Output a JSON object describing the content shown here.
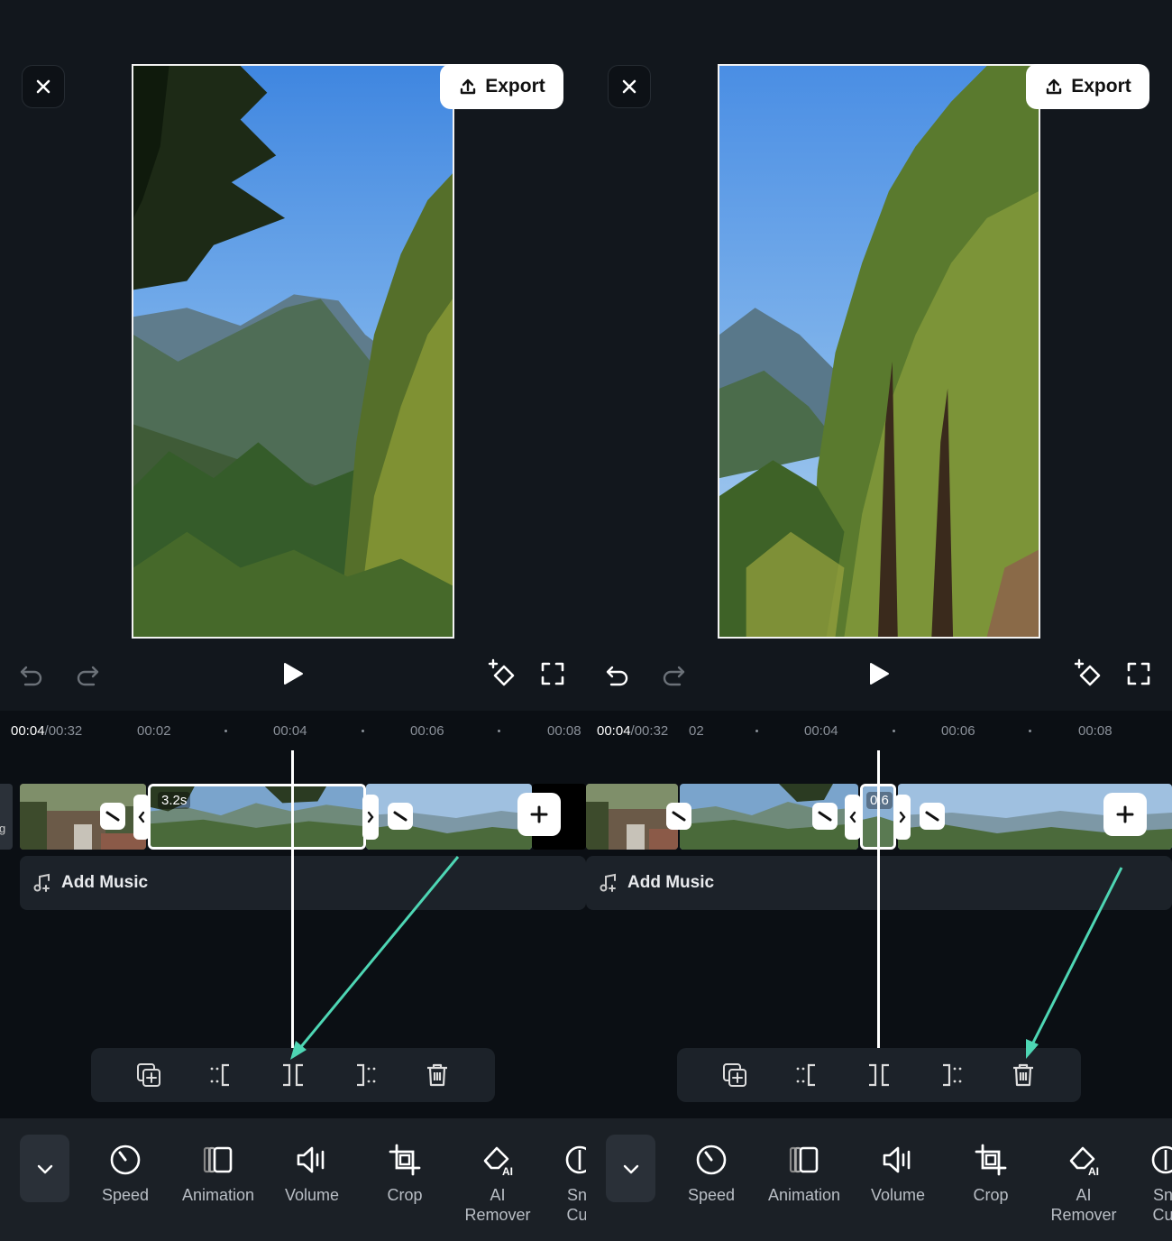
{
  "panels": [
    {
      "export_label": "Export",
      "timecode_current": "00:04",
      "timecode_total": "/00:32",
      "ruler_ticks": [
        "00:02",
        "00:04",
        "00:06",
        "00:08"
      ],
      "left_edge_text": "g",
      "selected_clip_duration": "3.2s",
      "add_music_label": "Add Music",
      "tools": [
        {
          "icon": "speed-icon",
          "label": "Speed"
        },
        {
          "icon": "animation-icon",
          "label": "Animation"
        },
        {
          "icon": "volume-icon",
          "label": "Volume"
        },
        {
          "icon": "crop-icon",
          "label": "Crop"
        },
        {
          "icon": "ai-remover-icon",
          "label": "AI\nRemover"
        },
        {
          "icon": "smart-cutout-icon",
          "label": "Sn\nCu"
        }
      ],
      "highlighted_action": "split-icon"
    },
    {
      "export_label": "Export",
      "timecode_current": "00:04",
      "timecode_total": "/00:32",
      "ruler_ticks": [
        "02",
        "00:04",
        "00:06",
        "00:08"
      ],
      "selected_clip_duration": "0.6",
      "add_music_label": "Add Music",
      "tools": [
        {
          "icon": "speed-icon",
          "label": "Speed"
        },
        {
          "icon": "animation-icon",
          "label": "Animation"
        },
        {
          "icon": "volume-icon",
          "label": "Volume"
        },
        {
          "icon": "crop-icon",
          "label": "Crop"
        },
        {
          "icon": "ai-remover-icon",
          "label": "AI\nRemover"
        },
        {
          "icon": "smart-cutout-icon",
          "label": "Sn\nCu"
        }
      ],
      "highlighted_action": "delete-icon"
    }
  ],
  "colors": {
    "background": "#12171d",
    "timeline_bg": "#0b0f14",
    "toolbar_bg": "#1c2229",
    "arrow": "#4ed6b4",
    "accent_white": "#ffffff"
  }
}
